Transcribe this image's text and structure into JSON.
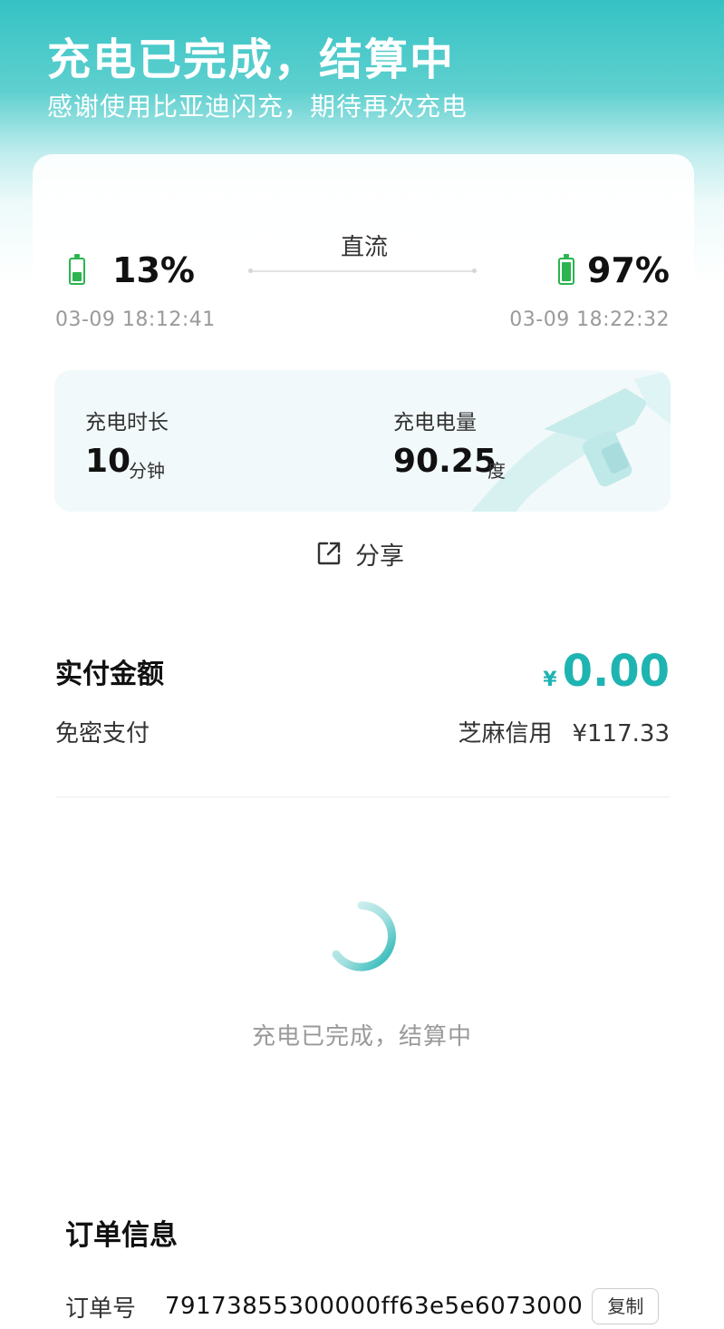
{
  "header": {
    "title": "充电已完成，结算中",
    "subtitle": "感谢使用比亚迪闪充，期待再次充电"
  },
  "charging": {
    "mode": "直流",
    "start": {
      "percent_label": "13%",
      "time": "03-09 18:12:41",
      "level": 0.13
    },
    "end": {
      "percent_label": "97%",
      "time": "03-09 18:22:32",
      "level": 0.97
    },
    "duration": {
      "label": "充电时长",
      "value": "10",
      "unit": "分钟"
    },
    "energy": {
      "label": "充电电量",
      "value": "90.25",
      "unit": "度"
    }
  },
  "share": {
    "label": "分享"
  },
  "payment": {
    "title": "实付金额",
    "currency": "¥",
    "amount": "0.00",
    "method": "免密支付",
    "credit_label": "芝麻信用",
    "credit_amount": "¥117.33"
  },
  "status": {
    "text": "充电已完成，结算中"
  },
  "order": {
    "title": "订单信息",
    "number_label": "订单号",
    "number": "79173855300000ff63e5e6073000",
    "copy_label": "复制"
  },
  "colors": {
    "accent": "#1eb4b2",
    "battery": "#2bb44f",
    "header_bg": "#35c2c4"
  }
}
